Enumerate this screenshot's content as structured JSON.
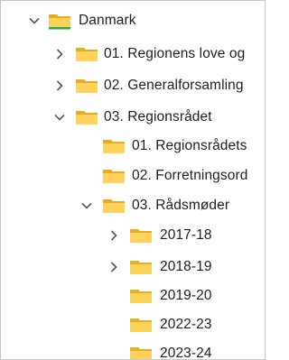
{
  "tree": {
    "items": [
      {
        "label": "Danmark",
        "expanded": true,
        "icon": "folder-icon-synced"
      },
      {
        "label": "01. Regionens love og",
        "expanded": false,
        "icon": "folder-icon"
      },
      {
        "label": "02. Generalforsamling",
        "expanded": false,
        "icon": "folder-icon"
      },
      {
        "label": "03. Regionsrådet",
        "expanded": true,
        "icon": "folder-icon"
      },
      {
        "label": "01. Regionsrådets",
        "icon": "folder-icon"
      },
      {
        "label": "02. Forretningsord",
        "icon": "folder-icon"
      },
      {
        "label": "03. Rådsmøder",
        "expanded": true,
        "icon": "folder-icon"
      },
      {
        "label": "2017-18",
        "expanded": false,
        "icon": "folder-icon"
      },
      {
        "label": "2018-19",
        "expanded": false,
        "icon": "folder-icon"
      },
      {
        "label": "2019-20",
        "icon": "folder-icon"
      },
      {
        "label": "2022-23",
        "icon": "folder-icon"
      },
      {
        "label": "2023-24",
        "icon": "folder-icon"
      }
    ]
  },
  "colors": {
    "folder_front": "#ffd35b",
    "folder_back": "#e6ad20",
    "sync_bar": "#2fa44f",
    "chevron": "#555555"
  }
}
